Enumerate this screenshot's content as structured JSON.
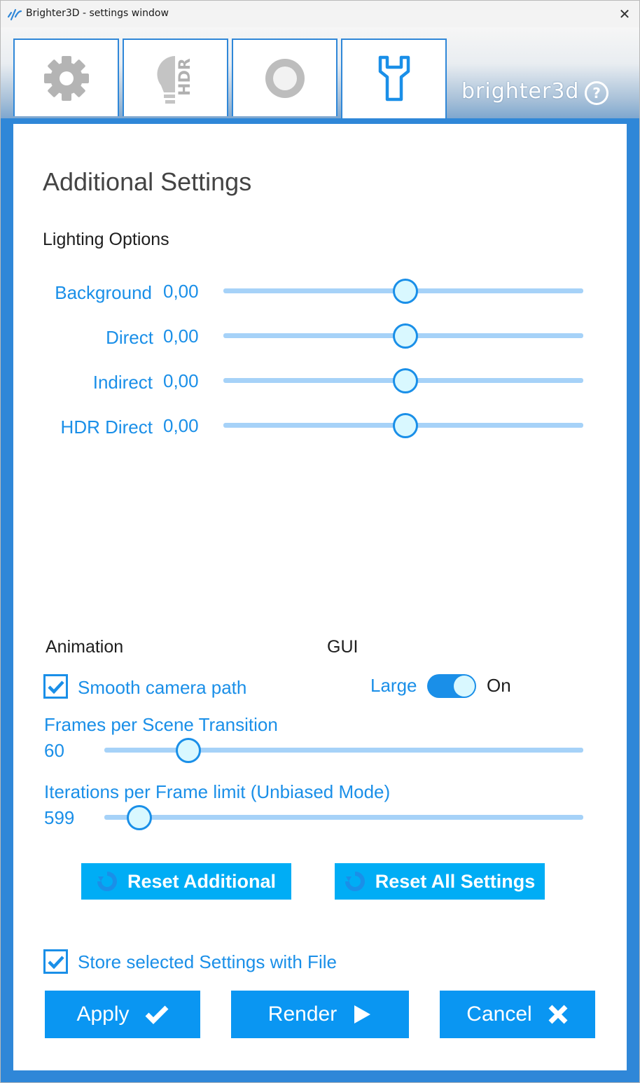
{
  "window": {
    "title": "Brighter3D - settings window",
    "close_glyph": "✕"
  },
  "tabs": [
    {
      "icon": "gear-icon"
    },
    {
      "icon": "hdr-bulb-icon",
      "text": "HDR"
    },
    {
      "icon": "material-sphere-icon"
    },
    {
      "icon": "wrench-icon",
      "active": true
    }
  ],
  "brand": {
    "text": "brighter3d",
    "help": "?"
  },
  "page": {
    "title": "Additional Settings",
    "lighting_title": "Lighting Options"
  },
  "lighting": [
    {
      "label": "Background",
      "value": "0,00",
      "fraction": 0.5
    },
    {
      "label": "Direct",
      "value": "0,00",
      "fraction": 0.5
    },
    {
      "label": "Indirect",
      "value": "0,00",
      "fraction": 0.5
    },
    {
      "label": "HDR Direct",
      "value": "0,00",
      "fraction": 0.5
    }
  ],
  "animation": {
    "title": "Animation",
    "smooth_label": "Smooth camera path",
    "smooth_checked": true,
    "frames_label": "Frames per Scene Transition",
    "frames_value": "60",
    "frames_fraction": 0.18,
    "iterations_label": "Iterations per Frame limit (Unbiased Mode)",
    "iterations_value": "599",
    "iterations_fraction": 0.07
  },
  "gui": {
    "title": "GUI",
    "size_label": "Large",
    "state": "On"
  },
  "buttons": {
    "reset_additional": "Reset Additional",
    "reset_all": "Reset All Settings",
    "store_label": "Store selected Settings with File",
    "apply": "Apply",
    "render": "Render",
    "cancel": "Cancel"
  },
  "colors": {
    "accent": "#1a8fe8",
    "button": "#0a96f2",
    "reset_button": "#00adf5",
    "frame": "#2f87d8"
  }
}
